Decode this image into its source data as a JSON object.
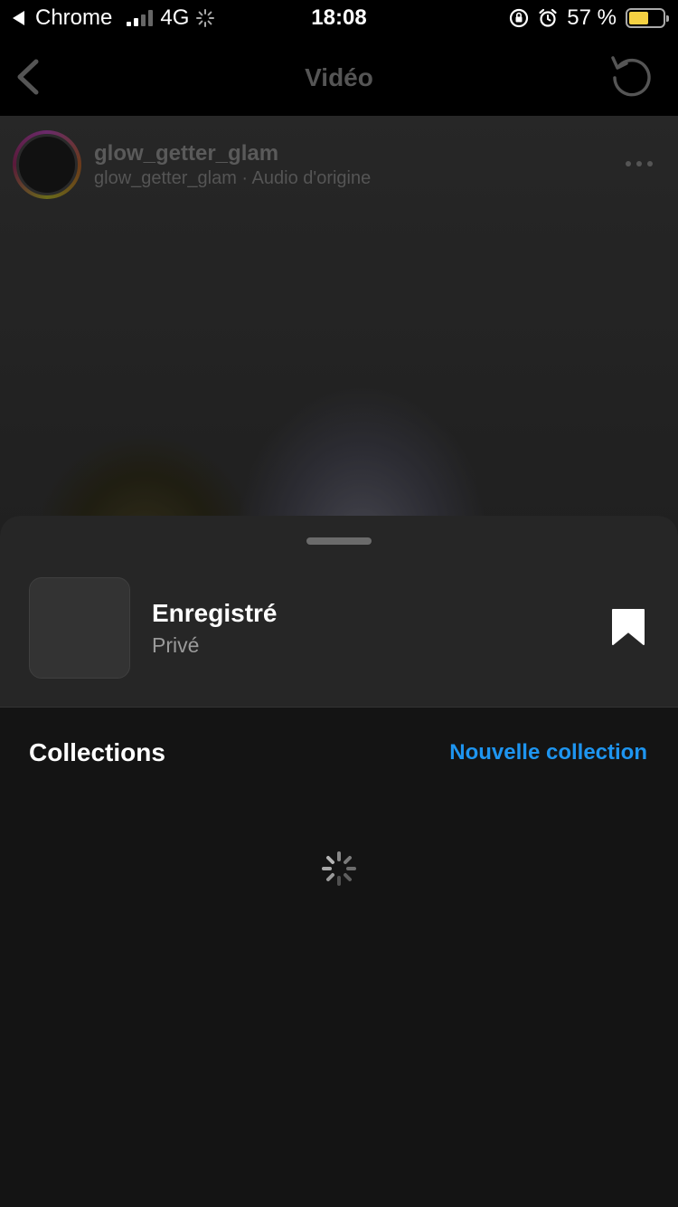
{
  "status_bar": {
    "app": "Chrome",
    "network": "4G",
    "time": "18:08",
    "battery": "57 %",
    "battery_level": 0.57,
    "battery_color": "#f5d142"
  },
  "nav": {
    "title": "Vidéo",
    "back_icon": "chevron-left-icon",
    "refresh_icon": "refresh-icon"
  },
  "post": {
    "username": "glow_getter_glam",
    "subline": "glow_getter_glam · Audio d'origine",
    "more_icon": "more-dots-icon"
  },
  "sheet": {
    "saved_title": "Enregistré",
    "saved_subtitle": "Privé",
    "bookmark_icon": "bookmark-filled-icon",
    "collections_label": "Collections",
    "new_collection_label": "Nouvelle collection",
    "accent_color": "#1e95f0"
  }
}
